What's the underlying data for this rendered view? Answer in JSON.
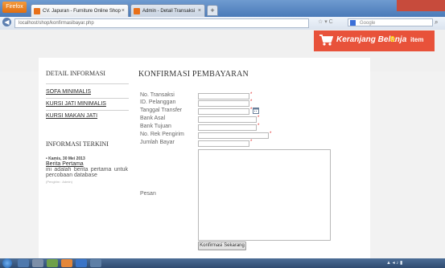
{
  "browser": {
    "app_button": "Firefox",
    "tabs": [
      {
        "label": "CV. Japuran - Furniture Online Shop"
      },
      {
        "label": "Admin - Detail Transaksi"
      }
    ],
    "new_tab": "+",
    "url": "localhost/shop/konfirmasibayar.php",
    "search_placeholder": "Google",
    "nav_tools": "☆ ▾ C"
  },
  "cart": {
    "label": "Keranjang Belanja",
    "count": "0",
    "unit": "item"
  },
  "sidebar": {
    "heading": "DETAIL INFORMASI",
    "links": [
      "SOFA MINIMALIS",
      "KURSI JATI MINIMALIS",
      "KURSI MAKAN JATI"
    ],
    "news_heading": "INFORMASI TERKINI",
    "news": {
      "date": "• Kamis, 30 Mei 2013",
      "title": "Berita Pertama",
      "body": "ini adalah berita pertama untuk percobaan database",
      "meta": "(Pengirim : Admin)"
    }
  },
  "form": {
    "title": "KONFIRMASI PEMBAYARAN",
    "fields": [
      {
        "label": "No. Transaksi",
        "value": "",
        "req": "*"
      },
      {
        "label": "ID. Pelanggan",
        "value": "",
        "req": "*"
      },
      {
        "label": "Tanggal Transfer",
        "value": "",
        "req": "*"
      },
      {
        "label": "Bank Asal",
        "value": "",
        "req": "*"
      },
      {
        "label": "Bank Tujuan",
        "value": "",
        "req": "*"
      },
      {
        "label": "No. Rek Pengirim",
        "value": "",
        "req": "*"
      },
      {
        "label": "Jumlah Bayar",
        "value": "",
        "req": "*"
      }
    ],
    "message_label": "Pesan",
    "message_value": "",
    "submit": "Konfirmasi Sekarang"
  },
  "colors": {
    "cart_bg": "#e8523a",
    "cart_count": "#ffe600",
    "required": "#e02020"
  },
  "icons": [
    "firefox-icon",
    "back-arrow-icon",
    "calendar-icon",
    "cart-icon",
    "search-icon",
    "windows-start-icon"
  ]
}
